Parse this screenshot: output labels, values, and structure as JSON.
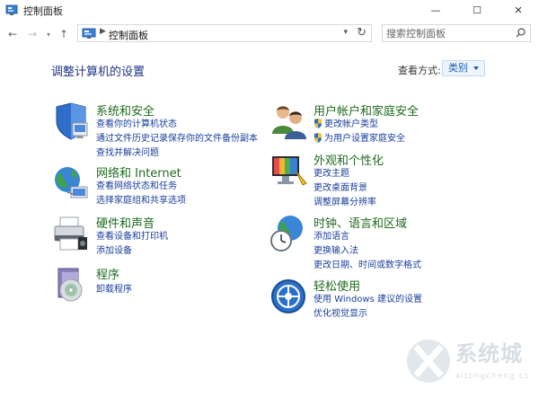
{
  "window": {
    "title": "控制面板",
    "minimize_label": "—",
    "maximize_label": "☐",
    "close_label": "✕"
  },
  "address_bar": {
    "back_icon": "back-arrow-icon",
    "forward_icon": "forward-arrow-icon",
    "up_icon": "up-arrow-icon",
    "breadcrumb": "控制面板",
    "search_placeholder": "搜索控制面板"
  },
  "page": {
    "title": "调整计算机的设置",
    "view_by_label": "查看方式:",
    "view_by_value": "类别"
  },
  "categories_left": [
    {
      "heading": "系统和安全",
      "icon": "system-security-shield-icon",
      "links": [
        "查看你的计算机状态",
        "通过文件历史记录保存你的文件备份副本",
        "查找并解决问题"
      ]
    },
    {
      "heading": "网络和 Internet",
      "icon": "network-globe-icon",
      "links": [
        "查看网络状态和任务",
        "选择家庭组和共享选项"
      ]
    },
    {
      "heading": "硬件和声音",
      "icon": "printer-icon",
      "links": [
        "查看设备和打印机",
        "添加设备"
      ]
    },
    {
      "heading": "程序",
      "icon": "programs-disc-icon",
      "links": [
        "卸载程序"
      ]
    }
  ],
  "categories_right": [
    {
      "heading": "用户帐户和家庭安全",
      "icon": "users-icon",
      "links": [
        "更改帐户类型",
        "为用户设置家庭安全"
      ]
    },
    {
      "heading": "外观和个性化",
      "icon": "appearance-monitor-icon",
      "links": [
        "更改主题",
        "更改桌面背景",
        "调整屏幕分辨率"
      ]
    },
    {
      "heading": "时钟、语言和区域",
      "icon": "clock-globe-icon",
      "links": [
        "添加语言",
        "更换输入法",
        "更改日期、时间或数字格式"
      ]
    },
    {
      "heading": "轻松使用",
      "icon": "ease-of-access-icon",
      "links": [
        "使用 Windows 建议的设置",
        "优化视觉显示"
      ]
    }
  ],
  "watermark": {
    "text": "系统城",
    "url": "xitongcheng.cc"
  }
}
